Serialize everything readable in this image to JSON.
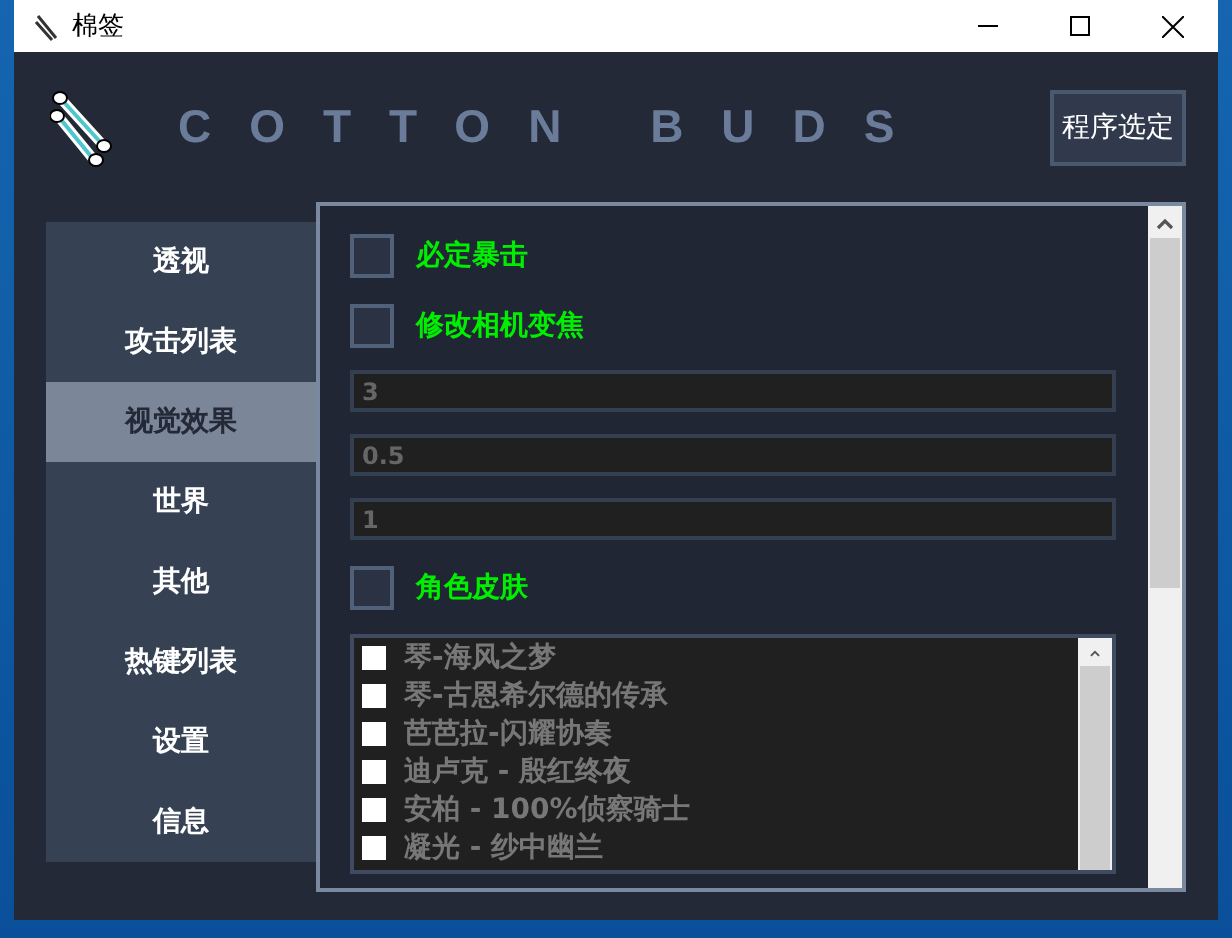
{
  "window": {
    "title": "棉签"
  },
  "header": {
    "brand": "COTTON BUDS",
    "select_button": "程序选定"
  },
  "sidebar": {
    "items": [
      {
        "label": "透视",
        "selected": false
      },
      {
        "label": "攻击列表",
        "selected": false
      },
      {
        "label": "视觉效果",
        "selected": true
      },
      {
        "label": "世界",
        "selected": false
      },
      {
        "label": "其他",
        "selected": false
      },
      {
        "label": "热键列表",
        "selected": false
      },
      {
        "label": "设置",
        "selected": false
      },
      {
        "label": "信息",
        "selected": false
      }
    ]
  },
  "content": [
    {
      "kind": "checkbox",
      "label": "必定暴击",
      "checked": false
    },
    {
      "kind": "checkbox",
      "label": "修改相机变焦",
      "checked": false
    },
    {
      "kind": "field",
      "value": "3"
    },
    {
      "kind": "field",
      "value": "0.5"
    },
    {
      "kind": "field",
      "value": "1"
    },
    {
      "kind": "checkbox",
      "label": "角色皮肤",
      "checked": false
    }
  ],
  "skins": [
    {
      "label": "琴-海风之梦",
      "checked": false
    },
    {
      "label": "琴-古恩希尔德的传承",
      "checked": false
    },
    {
      "label": "芭芭拉-闪耀协奏",
      "checked": false
    },
    {
      "label": "迪卢克 - 殷红终夜",
      "checked": false
    },
    {
      "label": "安柏 - 100%侦察骑士",
      "checked": false
    },
    {
      "label": "凝光 - 纱中幽兰",
      "checked": false
    }
  ]
}
